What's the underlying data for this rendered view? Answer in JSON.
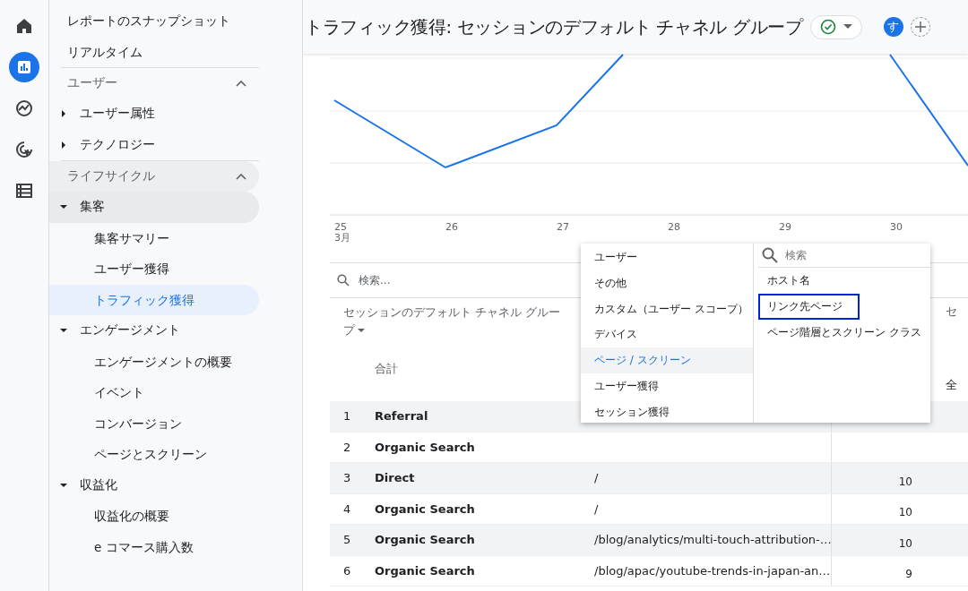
{
  "rail": [
    {
      "kind": "home",
      "selected": false
    },
    {
      "kind": "reports",
      "selected": true
    },
    {
      "kind": "explore",
      "selected": false
    },
    {
      "kind": "advertising",
      "selected": false
    },
    {
      "kind": "configure",
      "selected": false
    }
  ],
  "nav": {
    "links": [
      {
        "label": "レポートのスナップショット"
      },
      {
        "label": "リアルタイム"
      }
    ],
    "sections": [
      {
        "label": "ユーザー",
        "expanded": true,
        "highlighted": false,
        "children": [
          {
            "label": "ユーザー属性",
            "expanded": false,
            "highlighted": false
          },
          {
            "label": "テクノロジー",
            "expanded": false,
            "highlighted": false
          }
        ]
      },
      {
        "label": "ライフサイクル",
        "expanded": true,
        "highlighted": true,
        "children": [
          {
            "label": "集客",
            "expanded": true,
            "highlighted": true,
            "children": [
              {
                "label": "集客サマリー",
                "selected": false
              },
              {
                "label": "ユーザー獲得",
                "selected": false
              },
              {
                "label": "トラフィック獲得",
                "selected": true
              }
            ]
          },
          {
            "label": "エンゲージメント",
            "expanded": true,
            "highlighted": false,
            "children": [
              {
                "label": "エンゲージメントの概要",
                "selected": false
              },
              {
                "label": "イベント",
                "selected": false
              },
              {
                "label": "コンバージョン",
                "selected": false
              },
              {
                "label": "ページとスクリーン",
                "selected": false
              }
            ]
          },
          {
            "label": "収益化",
            "expanded": true,
            "highlighted": false,
            "children": [
              {
                "label": "収益化の概要",
                "selected": false
              },
              {
                "label": "e コマース購入数",
                "selected": false
              }
            ]
          }
        ]
      }
    ]
  },
  "header": {
    "title": "トラフィック獲得: セッションのデフォルト チャネル グループ",
    "avatar": "す"
  },
  "chart": {
    "x_labels": [
      "25",
      "26",
      "27",
      "28",
      "29",
      "30"
    ],
    "month": "3月"
  },
  "table": {
    "search": {
      "placeholder": "検索..."
    },
    "columns": [
      {
        "label": "セッションのデフォルト チャネル グループ",
        "total": "合計"
      },
      {
        "label": "セ",
        "total": "全"
      }
    ],
    "rows": [
      {
        "rank": "1",
        "channel": "Referral"
      },
      {
        "rank": "2",
        "channel": "Organic Search"
      },
      {
        "rank": "3",
        "channel": "Direct",
        "page": "/",
        "value": "10"
      },
      {
        "rank": "4",
        "channel": "Organic Search",
        "page": "/",
        "value": "10"
      },
      {
        "rank": "5",
        "channel": "Organic Search",
        "page": "/blog/analytics/multi-touch-attribution-…",
        "value": "10"
      },
      {
        "rank": "6",
        "channel": "Organic Search",
        "page": "/blog/apac/youtube-trends-in-japan-an…",
        "value": "9"
      }
    ]
  },
  "dropdown": {
    "categories": [
      {
        "label": "ユーザー",
        "selected": false
      },
      {
        "label": "その他",
        "selected": false
      },
      {
        "label": "カスタム（ユーザー スコープ）",
        "selected": false
      },
      {
        "label": "デバイス",
        "selected": false
      },
      {
        "label": "ページ / スクリーン",
        "selected": true
      },
      {
        "label": "ユーザー獲得",
        "selected": false
      },
      {
        "label": "セッション獲得",
        "selected": false
      }
    ],
    "search": {
      "placeholder": "検索"
    },
    "options": [
      {
        "label": "ホスト名",
        "focused": false
      },
      {
        "label": "リンク先ページ",
        "focused": true
      },
      {
        "label": "ページ階層とスクリーン クラス",
        "focused": false
      }
    ]
  }
}
